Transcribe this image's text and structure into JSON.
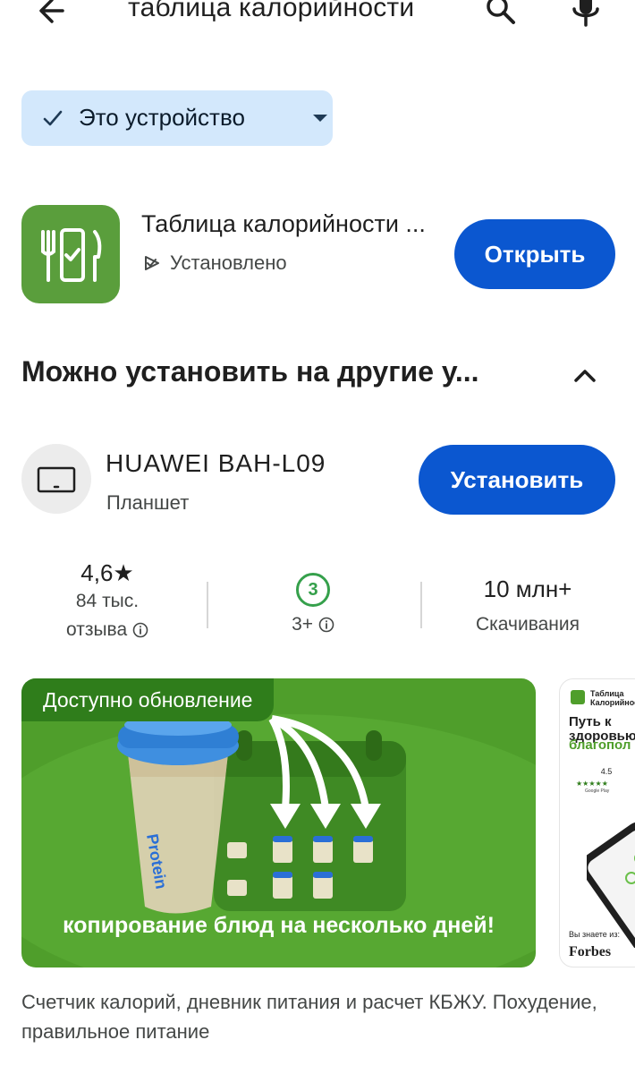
{
  "search": {
    "query": "таблица калорийности"
  },
  "filter_chip": {
    "label": "Это устройство"
  },
  "app": {
    "title": "Таблица калорийности ...",
    "status": "Установлено",
    "open_label": "Открыть",
    "icon_color": "#5a9e3c"
  },
  "other_devices": {
    "section_title": "Можно установить на другие у...",
    "device": {
      "name": "HUAWEI BAH-L09",
      "type": "Планшет",
      "install_label": "Установить"
    }
  },
  "stats": {
    "rating": "4,6★",
    "reviews_count": "84 тыс.",
    "reviews_label": "отзыва",
    "age_rating": "3",
    "age_label": "3+",
    "downloads": "10 млн+",
    "downloads_label": "Скачивания"
  },
  "screenshots": {
    "promo_badge": "Доступно обновление",
    "promo_caption": "копирование блюд на несколько дней!",
    "promo_cup_text": "Protein",
    "shot2": {
      "app_name": "Таблица Калорийност",
      "headline_1": "Путь к здоровью",
      "headline_2": "благопол",
      "rating": "4.5",
      "stars": "★★★★★",
      "store": "Google Play",
      "known_from": "Вы знаете из:",
      "brand": "Forbes"
    }
  },
  "description": "Счетчик калорий, дневник питания и расчет КБЖУ. Похудение, правильное питание",
  "colors": {
    "primary_button": "#0b57d0",
    "chip_bg": "#d3e8fc",
    "promo_green": "#4f9e2b",
    "age_green": "#35a04b"
  }
}
